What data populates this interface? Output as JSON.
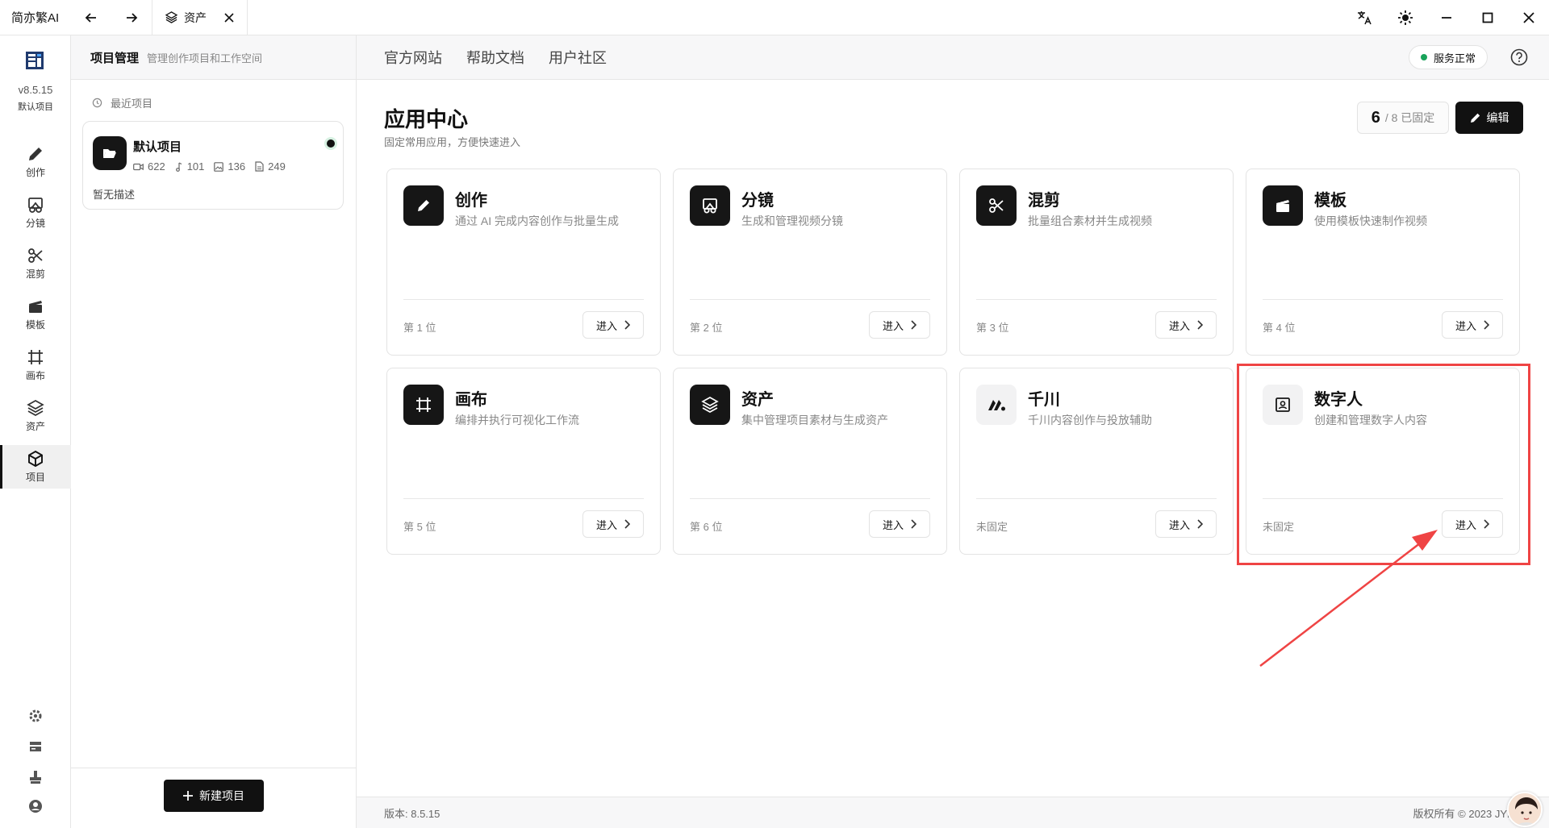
{
  "titlebar": {
    "app_name": "简亦繁AI",
    "active_tab": "资产"
  },
  "sidebar": {
    "version": "v8.5.15",
    "project": "默认项目",
    "items": [
      {
        "label": "创作",
        "icon": "pencil-icon"
      },
      {
        "label": "分镜",
        "icon": "storyboard-icon"
      },
      {
        "label": "混剪",
        "icon": "scissors-icon"
      },
      {
        "label": "模板",
        "icon": "clapper-icon"
      },
      {
        "label": "画布",
        "icon": "canvas-frame-icon"
      },
      {
        "label": "资产",
        "icon": "layers-icon"
      },
      {
        "label": "项目",
        "icon": "cube-icon",
        "active": true
      }
    ],
    "bottom_icons": [
      "gear-icon",
      "server-icon",
      "stamp-icon",
      "user-circle-icon"
    ]
  },
  "project_panel": {
    "title": "项目管理",
    "subtitle": "管理创作项目和工作空间",
    "recent_label": "最近项目",
    "card": {
      "name": "默认项目",
      "videos": "622",
      "audio": "101",
      "images": "136",
      "docs": "249",
      "description": "暂无描述"
    },
    "new_button": "新建项目"
  },
  "top_nav": {
    "links": [
      "官方网站",
      "帮助文档",
      "用户社区"
    ],
    "status": "服务正常",
    "status_color": "#19a35a"
  },
  "app_center": {
    "title": "应用中心",
    "subtitle": "固定常用应用，方便快速进入",
    "pinned_count": "6",
    "pinned_total": "/ 8 已固定",
    "edit_label": "编辑",
    "enter_label": "进入",
    "apps": [
      {
        "title": "创作",
        "desc": "通过 AI 完成内容创作与批量生成",
        "pos": "第 1 位"
      },
      {
        "title": "分镜",
        "desc": "生成和管理视频分镜",
        "pos": "第 2 位"
      },
      {
        "title": "混剪",
        "desc": "批量组合素材并生成视频",
        "pos": "第 3 位"
      },
      {
        "title": "模板",
        "desc": "使用模板快速制作视频",
        "pos": "第 4 位"
      },
      {
        "title": "画布",
        "desc": "编排并执行可视化工作流",
        "pos": "第 5 位"
      },
      {
        "title": "资产",
        "desc": "集中管理项目素材与生成资产",
        "pos": "第 6 位"
      },
      {
        "title": "千川",
        "desc": "千川内容创作与投放辅助",
        "pos": "未固定"
      },
      {
        "title": "数字人",
        "desc": "创建和管理数字人内容",
        "pos": "未固定"
      }
    ]
  },
  "footer": {
    "version": "版本: 8.5.15",
    "copyright": "版权所有 © 2023 JYF"
  },
  "annotation_color": "#ef4444"
}
